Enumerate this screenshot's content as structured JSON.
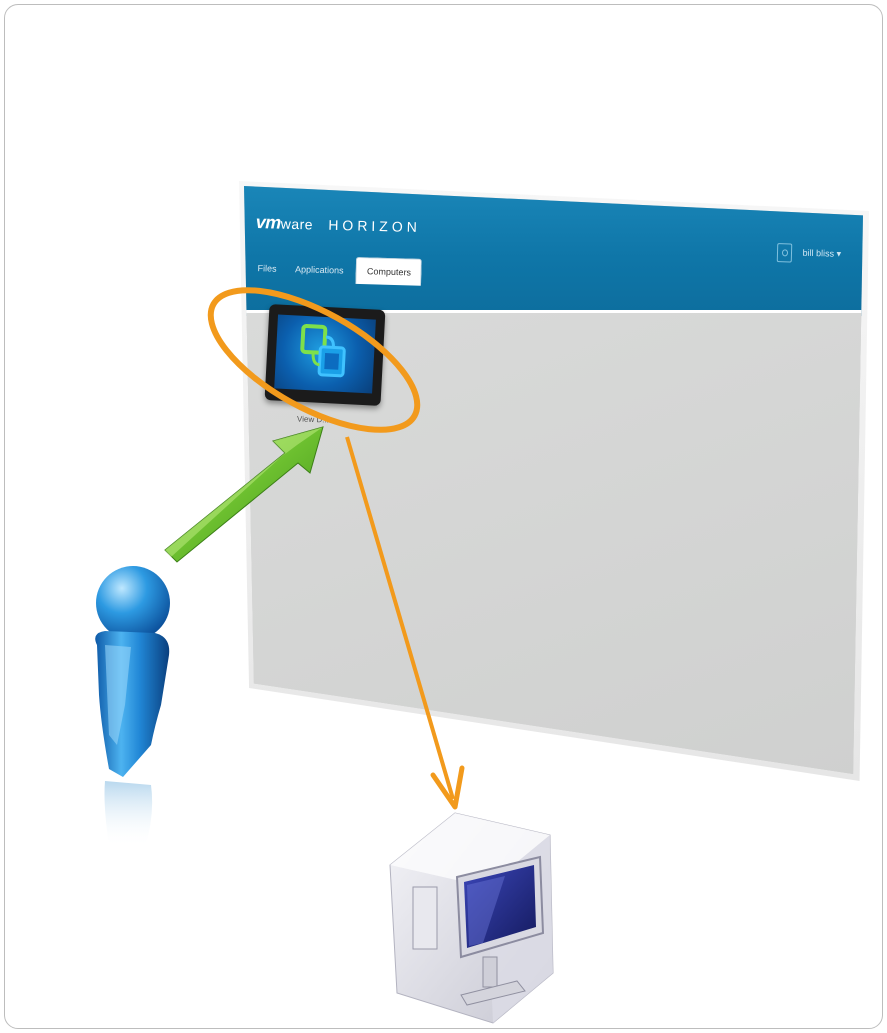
{
  "window": {
    "brand_vm": "vm",
    "brand_ware": "ware",
    "brand_product": "HORIZON",
    "tabs": [
      {
        "label": "Files",
        "active": false
      },
      {
        "label": "Applications",
        "active": false
      },
      {
        "label": "Computers",
        "active": true
      }
    ],
    "user_name": "bill bliss",
    "user_menu_glyph": "▾"
  },
  "tile": {
    "label": "View D..."
  },
  "colors": {
    "header_blue": "#1482b6",
    "highlight_orange": "#f29a1c",
    "arrow_green": "#6cbf2f",
    "user_figure_blue": "#1f8fd6"
  },
  "icons": {
    "user_figure": "person-icon",
    "desktop_box": "desktop-pc-icon",
    "view_app": "vmware-view-icon"
  }
}
